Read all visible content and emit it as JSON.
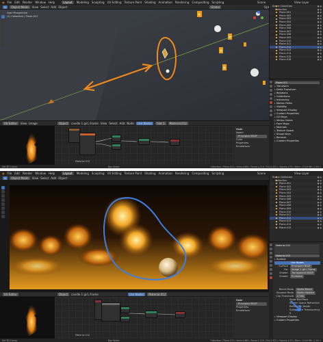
{
  "top": {
    "menubar": {
      "menus": [
        "File",
        "Edit",
        "Render",
        "Window",
        "Help"
      ],
      "workspaces": [
        "Layout",
        "Modeling",
        "Sculpting",
        "UV Editing",
        "Texture Paint",
        "Shading",
        "Animation",
        "Rendering",
        "Compositing",
        "Scripting"
      ],
      "scene": "Scene",
      "view_layer": "View Layer"
    },
    "viewport_header": {
      "mode": "Object Mode",
      "menus": [
        "View",
        "Select",
        "Add",
        "Object"
      ],
      "orientation": "Global",
      "options": "Options"
    },
    "viewport_info": [
      "User Perspective",
      "(1) Collection | Plane.012"
    ],
    "annotation_color": "#f28a1c",
    "outliner": {
      "title": "Scene Collection",
      "collection": "Collection",
      "items": [
        "Plane.001",
        "Plane.002",
        "Plane.003",
        "Plane.004",
        "Plane.005",
        "Plane.006",
        "Plane.007",
        "Plane.008",
        "Plane.009",
        "Plane.010",
        "Plane.011",
        "Plane.012",
        "Plane.013",
        "Plane.014",
        "Plane.015",
        "Plane.016"
      ]
    },
    "properties": {
      "object_name": "Plane.012",
      "sections": [
        "Transform",
        "Delta Transform",
        "Relations",
        "Collections",
        "Instancing",
        "Motion Paths",
        "Visibility",
        "Viewport Display",
        "Custom Properties"
      ],
      "subsections": [
        "UV Maps",
        "Vertex Colors",
        "Face Maps",
        "Normals",
        "Texture Space",
        "Shape Keys",
        "Remesh",
        "Custom Properties"
      ]
    },
    "image_header": {
      "editor": "UV Editor",
      "menus": [
        "View",
        "Image"
      ],
      "image_name": "candle 1 girl, Frame"
    },
    "node_header": {
      "editor": "Object",
      "menus": [
        "View",
        "Select",
        "Add",
        "Node"
      ],
      "use_nodes": "Use Nodes",
      "slot": "Slot 1",
      "material": "Material.012"
    },
    "node_sidebar": {
      "node_name": "Node",
      "name_field": "Name",
      "label_field": "Principled BSDF",
      "properties": "Properties",
      "emulations": "Emulations",
      "color": "Color"
    },
    "material_label": "Material.012",
    "status_left": "Set 3D Cursor",
    "status_mid": "Box Select",
    "status_right": "Collection | Plane.012 | Verts:4,864 | Faces:1,216 | Tris:2,432 | Objects:1/33 | Mem: 119.6 MB | 2.90.1"
  },
  "bottom": {
    "viewport_header": {
      "mode": "Object Mode",
      "menus": [
        "View",
        "Select",
        "Add",
        "Object"
      ]
    },
    "annotation_color": "#3d7fe0",
    "properties": {
      "material": "Material.012",
      "surface": "Surface",
      "use_nodes": "Use Nodes",
      "surface_type": "Principled BSDF",
      "fields": [
        {
          "label": "Surface",
          "value": "Principled BSDF"
        },
        {
          "label": "Fac",
          "value": "Image 1 girl, Frame"
        },
        {
          "label": "Shader",
          "value": "Transparent BSDF"
        },
        {
          "label": "Shader",
          "value": "Emission"
        }
      ],
      "settings": [
        {
          "label": "Blend Mode",
          "value": "Alpha Blend"
        },
        {
          "label": "Shadow Mode",
          "value": "Alpha Hashed"
        },
        {
          "label": "Clip Threshold",
          "value": "0.500"
        }
      ],
      "checks": [
        "Show Backface",
        "Screen Space Refraction",
        "Refraction Depth",
        "Subsurface Translucency"
      ],
      "pass_index": "0",
      "footer_sections": [
        "Viewport Display",
        "Custom Properties"
      ]
    },
    "image_header": {
      "editor": "UV Editor",
      "image_name": "candle 1 girl, Frame"
    },
    "node_header": {
      "editor": "Object",
      "use_nodes": "Use Nodes",
      "material": "Material.012"
    },
    "node_sidebar": {
      "node_name": "Node",
      "label_field": "Principled BSDF",
      "properties": "Properties",
      "emulations": "Emulations"
    },
    "material_label": "Material.012",
    "status_right": "Collection | Plane.012 | Verts:4,864 | Faces:1,216 | Tris:2,432 | Objects:1/33 | Mem: 119.6 MB | 2.90.1"
  }
}
